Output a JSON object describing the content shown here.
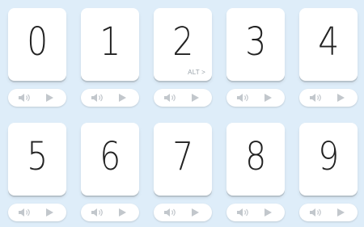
{
  "cards": [
    {
      "digit": "0",
      "alt": ""
    },
    {
      "digit": "1",
      "alt": ""
    },
    {
      "digit": "2",
      "alt": "ALT >"
    },
    {
      "digit": "3",
      "alt": ""
    },
    {
      "digit": "4",
      "alt": ""
    },
    {
      "digit": "5",
      "alt": ""
    },
    {
      "digit": "6",
      "alt": ""
    },
    {
      "digit": "7",
      "alt": ""
    },
    {
      "digit": "8",
      "alt": ""
    },
    {
      "digit": "9",
      "alt": ""
    }
  ],
  "icons": {
    "sound": "speaker-icon",
    "play": "play-icon"
  },
  "colors": {
    "background": "#deedf9",
    "card": "#ffffff",
    "icon": "#c2c7cc",
    "digit": "#222222"
  }
}
